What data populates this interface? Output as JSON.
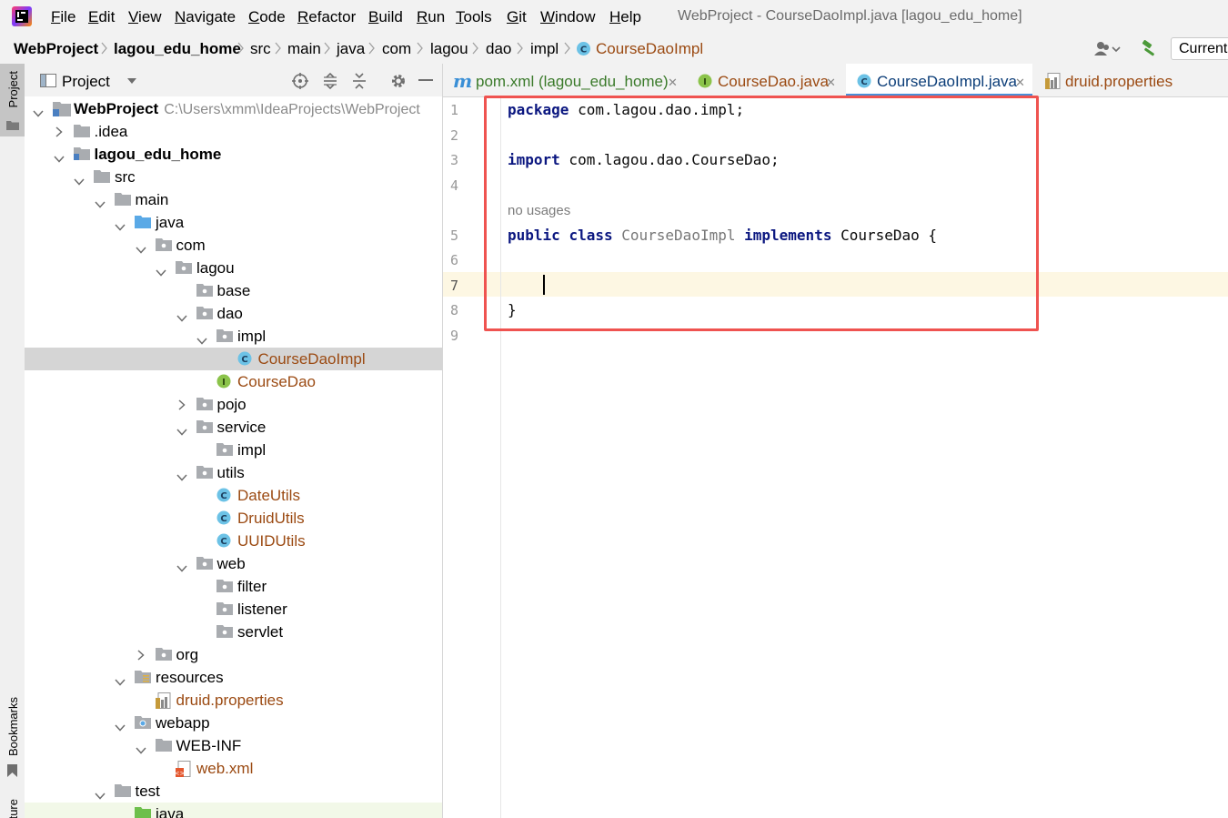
{
  "window": {
    "title": "WebProject - CourseDaoImpl.java [lagou_edu_home]"
  },
  "menu": [
    {
      "mn": "F",
      "rest": "ile"
    },
    {
      "mn": "E",
      "rest": "dit"
    },
    {
      "mn": "V",
      "rest": "iew"
    },
    {
      "mn": "N",
      "rest": "avigate"
    },
    {
      "mn": "C",
      "rest": "ode"
    },
    {
      "mn": "R",
      "rest": "efactor"
    },
    {
      "mn": "B",
      "rest": "uild"
    },
    {
      "mn": "R",
      "rest": "un"
    },
    {
      "mn": "T",
      "rest": "ools"
    },
    {
      "mn": "G",
      "rest": "it"
    },
    {
      "mn": "W",
      "rest": "indow"
    },
    {
      "mn": "H",
      "rest": "elp"
    }
  ],
  "breadcrumbs": [
    "WebProject",
    "lagou_edu_home",
    "src",
    "main",
    "java",
    "com",
    "lagou",
    "dao",
    "impl",
    "CourseDaoImpl"
  ],
  "toolbar": {
    "run_config": "Current File"
  },
  "toolstrip": {
    "project_label": "Project",
    "bookmarks_label": "Bookmarks",
    "structure_label": "Structure"
  },
  "project_panel": {
    "title": "Project",
    "tree": [
      {
        "label": "WebProject",
        "path": "C:\\Users\\xmm\\IdeaProjects\\WebProject"
      },
      {
        "label": ".idea"
      },
      {
        "label": "lagou_edu_home"
      },
      {
        "label": "src"
      },
      {
        "label": "main"
      },
      {
        "label": "java"
      },
      {
        "label": "com"
      },
      {
        "label": "lagou"
      },
      {
        "label": "base"
      },
      {
        "label": "dao"
      },
      {
        "label": "impl"
      },
      {
        "label": "CourseDaoImpl"
      },
      {
        "label": "CourseDao"
      },
      {
        "label": "pojo"
      },
      {
        "label": "service"
      },
      {
        "label": "impl"
      },
      {
        "label": "utils"
      },
      {
        "label": "DateUtils"
      },
      {
        "label": "DruidUtils"
      },
      {
        "label": "UUIDUtils"
      },
      {
        "label": "web"
      },
      {
        "label": "filter"
      },
      {
        "label": "listener"
      },
      {
        "label": "servlet"
      },
      {
        "label": "org"
      },
      {
        "label": "resources"
      },
      {
        "label": "druid.properties"
      },
      {
        "label": "webapp"
      },
      {
        "label": "WEB-INF"
      },
      {
        "label": "web.xml"
      },
      {
        "label": "test"
      },
      {
        "label": "java"
      }
    ]
  },
  "editor": {
    "tabs": [
      {
        "icon": "m",
        "label": "pom.xml (lagou_edu_home)"
      },
      {
        "icon": "I",
        "label": "CourseDao.java"
      },
      {
        "icon": "C",
        "label": "CourseDaoImpl.java"
      },
      {
        "icon": "",
        "label": "druid.properties"
      }
    ],
    "line_numbers": [
      "1",
      "2",
      "3",
      "4",
      "5",
      "6",
      "7",
      "8",
      "9"
    ],
    "inlay_hint": "no usages",
    "code": {
      "l1_kw": "package",
      "l1_rest": " com.lagou.dao.impl;",
      "l3_kw": "import",
      "l3_rest": " com.lagou.dao.CourseDao;",
      "l5_kw1": "public",
      "l5_kw2": "class",
      "l5_name": "CourseDaoImpl",
      "l5_kw3": "implements",
      "l5_rest": " CourseDao {",
      "l8": "}"
    }
  },
  "colors": {
    "keyword": "#0b1780",
    "class_name_in_tree": "#9b4a12",
    "highlight_box": "#ef5350",
    "caret_line": "#fdf7e3",
    "active_tab_underline": "#4a8fd8"
  }
}
